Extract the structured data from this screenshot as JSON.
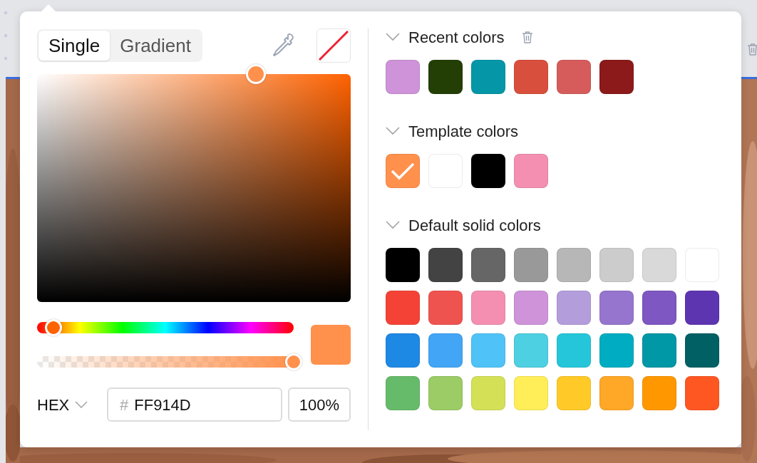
{
  "tabs": [
    {
      "label": "Single",
      "selected": true
    },
    {
      "label": "Gradient",
      "selected": false
    }
  ],
  "picker": {
    "hue": {
      "level": 0.064
    },
    "alpha": {
      "level": 1
    }
  },
  "format": {
    "label": "HEX"
  },
  "hex": {
    "prefix": "#",
    "value": "FF914D"
  },
  "opacity": {
    "value": "100%"
  },
  "sections": [
    {
      "kind": "recent",
      "title": "Recent colors",
      "expanded": true,
      "swatches": [
        {
          "color": "#ce93d8",
          "selected": false
        },
        {
          "color": "#233f06",
          "selected": false
        },
        {
          "color": "#0597a7",
          "selected": false
        },
        {
          "color": "#d94f3d",
          "selected": false
        },
        {
          "color": "#d65c5c",
          "selected": false
        },
        {
          "color": "#8c1a1a",
          "selected": false
        }
      ]
    },
    {
      "kind": "template",
      "title": "Template colors",
      "expanded": true,
      "swatches": [
        {
          "color": "#ff914d",
          "selected": true
        },
        {
          "color": "#ffffff",
          "selected": false
        },
        {
          "color": "#000000",
          "selected": false
        },
        {
          "color": "#f48fb1",
          "selected": false
        }
      ]
    },
    {
      "kind": "default",
      "title": "Default solid colors",
      "expanded": true,
      "swatches": [
        {
          "color": "#000000",
          "selected": false
        },
        {
          "color": "#434343",
          "selected": false
        },
        {
          "color": "#666666",
          "selected": false
        },
        {
          "color": "#999999",
          "selected": false
        },
        {
          "color": "#b7b7b7",
          "selected": false
        },
        {
          "color": "#cccccc",
          "selected": false
        },
        {
          "color": "#d9d9d9",
          "selected": false
        },
        {
          "color": "#ffffff",
          "selected": false
        },
        {
          "color": "#f44336",
          "selected": false
        },
        {
          "color": "#ef5350",
          "selected": false
        },
        {
          "color": "#f48fb1",
          "selected": false
        },
        {
          "color": "#ce93d8",
          "selected": false
        },
        {
          "color": "#b39ddb",
          "selected": false
        },
        {
          "color": "#9575cd",
          "selected": false
        },
        {
          "color": "#7e57c2",
          "selected": false
        },
        {
          "color": "#5e35b1",
          "selected": false
        },
        {
          "color": "#1e88e5",
          "selected": false
        },
        {
          "color": "#42a5f5",
          "selected": false
        },
        {
          "color": "#4fc3f7",
          "selected": false
        },
        {
          "color": "#4dd0e1",
          "selected": false
        },
        {
          "color": "#26c6da",
          "selected": false
        },
        {
          "color": "#00acc1",
          "selected": false
        },
        {
          "color": "#0097a7",
          "selected": false
        },
        {
          "color": "#006064",
          "selected": false
        },
        {
          "color": "#66bb6a",
          "selected": false
        },
        {
          "color": "#9ccc65",
          "selected": false
        },
        {
          "color": "#d4e157",
          "selected": false
        },
        {
          "color": "#ffee58",
          "selected": false
        },
        {
          "color": "#ffca28",
          "selected": false
        },
        {
          "color": "#ffa726",
          "selected": false
        },
        {
          "color": "#ff9800",
          "selected": false
        },
        {
          "color": "#ff5722",
          "selected": false
        }
      ]
    }
  ]
}
